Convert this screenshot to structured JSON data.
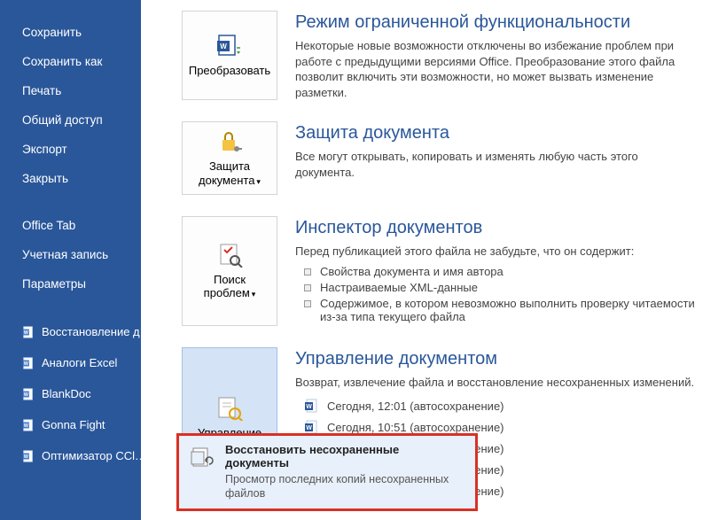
{
  "sidebar": {
    "group1": [
      {
        "label": "Сохранить"
      },
      {
        "label": "Сохранить как"
      },
      {
        "label": "Печать"
      },
      {
        "label": "Общий доступ"
      },
      {
        "label": "Экспорт"
      },
      {
        "label": "Закрыть"
      }
    ],
    "group2": [
      {
        "label": "Office Tab"
      },
      {
        "label": "Учетная запись"
      },
      {
        "label": "Параметры"
      }
    ],
    "docs": [
      {
        "label": "Восстановление д…"
      },
      {
        "label": "Аналоги Excel"
      },
      {
        "label": "BlankDoc"
      },
      {
        "label": "Gonna Fight"
      },
      {
        "label": "Оптимизатор CCl…"
      }
    ]
  },
  "sections": {
    "compat": {
      "tile": "Преобразовать",
      "title": "Режим ограниченной функциональности",
      "desc": "Некоторые новые возможности отключены во избежание проблем при работе с предыдущими версиями Office. Преобразование этого файла позволит включить эти возможности, но может вызвать изменение разметки."
    },
    "protect": {
      "tile": "Защита документа",
      "title": "Защита документа",
      "desc": "Все могут открывать, копировать и изменять любую часть этого документа."
    },
    "inspect": {
      "tile": "Поиск проблем",
      "title": "Инспектор документов",
      "desc": "Перед публикацией этого файла не забудьте, что он содержит:",
      "items": [
        "Свойства документа и имя автора",
        "Настраиваемые XML-данные",
        "Содержимое, в котором невозможно выполнить проверку читаемости из-за типа текущего файла"
      ]
    },
    "manage": {
      "tile": "Управление документом",
      "title": "Управление документом",
      "desc": "Возврат, извлечение файла и восстановление несохраненных изменений.",
      "versions": [
        "Сегодня, 12:01 (автосохранение)",
        "Сегодня, 10:51 (автосохранение)",
        "Сегодня, 10:31 (автосохранение)",
        "Сегодня, 10:21 (автосохранение)",
        "Сегодня, 10:06 (автосохранение)"
      ]
    }
  },
  "popup": {
    "title": "Восстановить несохраненные документы",
    "desc": "Просмотр последних копий несохраненных файлов"
  }
}
